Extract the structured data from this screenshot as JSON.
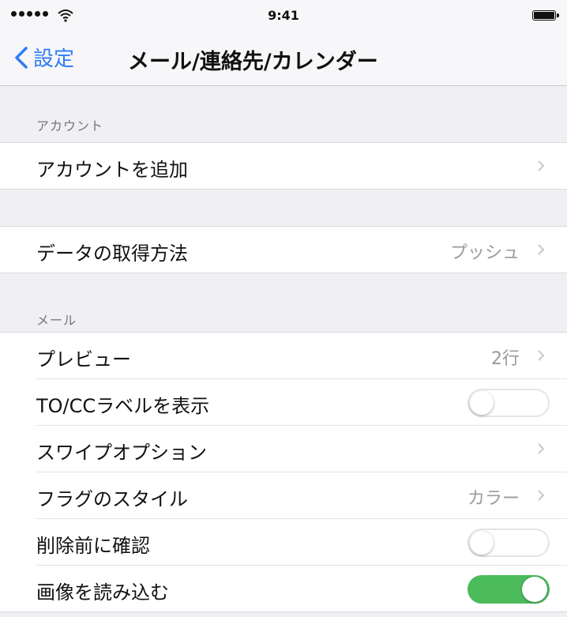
{
  "status_bar": {
    "time": "9:41"
  },
  "nav": {
    "back_label": "設定",
    "title": "メール/連絡先/カレンダー"
  },
  "sections": {
    "account": {
      "header": "アカウント",
      "add_account_label": "アカウントを追加"
    },
    "fetch": {
      "fetch_label": "データの取得方法",
      "fetch_value": "プッシュ"
    },
    "mail": {
      "header": "メール",
      "preview_label": "プレビュー",
      "preview_value": "2行",
      "show_to_cc_label": "TO/CCラベルを表示",
      "show_to_cc_on": false,
      "swipe_options_label": "スワイプオプション",
      "flag_style_label": "フラグのスタイル",
      "flag_style_value": "カラー",
      "ask_before_deleting_label": "削除前に確認",
      "ask_before_deleting_on": false,
      "load_images_label": "画像を読み込む",
      "load_images_on": true
    }
  },
  "colors": {
    "accent": "#2f7cf6",
    "toggle_on": "#4cbb5c",
    "background": "#efeff4"
  },
  "icons": {
    "back": "chevron-left-icon",
    "disclosure": "chevron-right-icon",
    "wifi": "wifi-icon",
    "battery": "battery-icon",
    "signal": "signal-dots-icon"
  }
}
